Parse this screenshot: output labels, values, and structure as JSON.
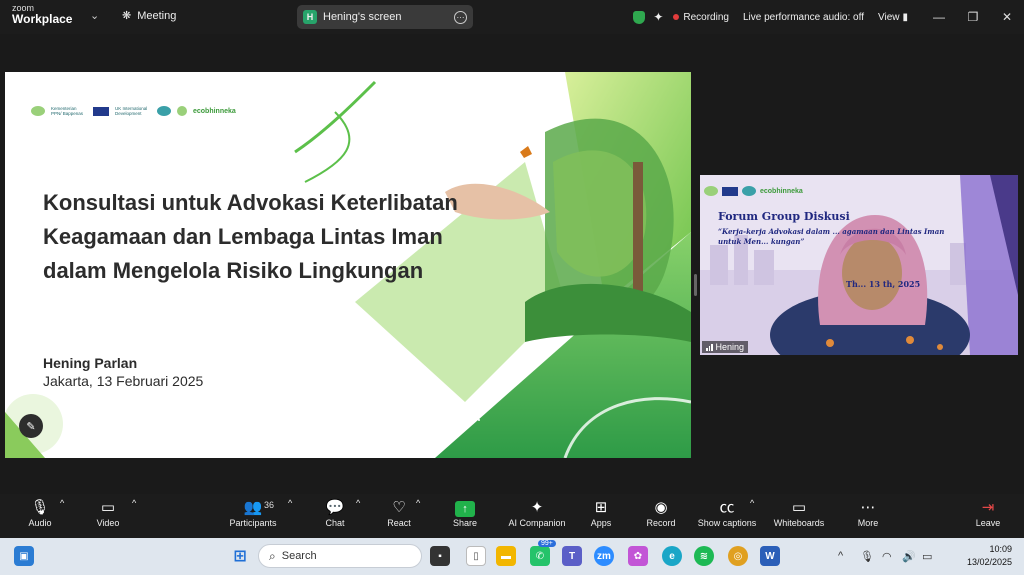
{
  "titlebar": {
    "brand_top": "zoom",
    "brand_bottom": "Workplace",
    "meeting_label": "Meeting",
    "screen_pill_badge": "H",
    "screen_pill_label": "Hening's screen",
    "recording_label": "Recording",
    "live_audio_label": "Live performance audio: off",
    "view_label": "View",
    "minimize": "—",
    "restore": "❐",
    "close": "✕"
  },
  "slide": {
    "title": "Konsultasi untuk Advokasi Keterlibatan Keagamaan dan Lembaga Lintas Iman dalam Mengelola Risiko Lingkungan",
    "author": "Hening Parlan",
    "date": "Jakarta, 13 Februari 2025",
    "logo1": "Kementerian PPN/ Bappenas",
    "logo2": "UK International Development",
    "logo4": "ecobhinneka"
  },
  "video": {
    "forum_title": "Forum Group Diskusi",
    "quote": "“Kerja-kerja Advokasi dalam ... agamaan dan Lintas Iman untuk Men... kungan”",
    "date": "Th... 13 th, 2025",
    "logo": "ecobhinneka",
    "participant_name": "Hening"
  },
  "toolbar": {
    "audio": "Audio",
    "video": "Video",
    "participants": "Participants",
    "participants_count": "36",
    "chat": "Chat",
    "react": "React",
    "share": "Share",
    "ai_companion": "AI Companion",
    "apps": "Apps",
    "record": "Record",
    "show_captions": "Show captions",
    "whiteboards": "Whiteboards",
    "more": "More",
    "leave": "Leave"
  },
  "taskbar": {
    "search_placeholder": "Search",
    "whatsapp_badge": "99+",
    "time": "10:09",
    "date": "13/02/2025"
  },
  "colors": {
    "accent_green": "#21b24b",
    "record_red": "#e23c3c",
    "slide_green": "#6cc24a"
  }
}
